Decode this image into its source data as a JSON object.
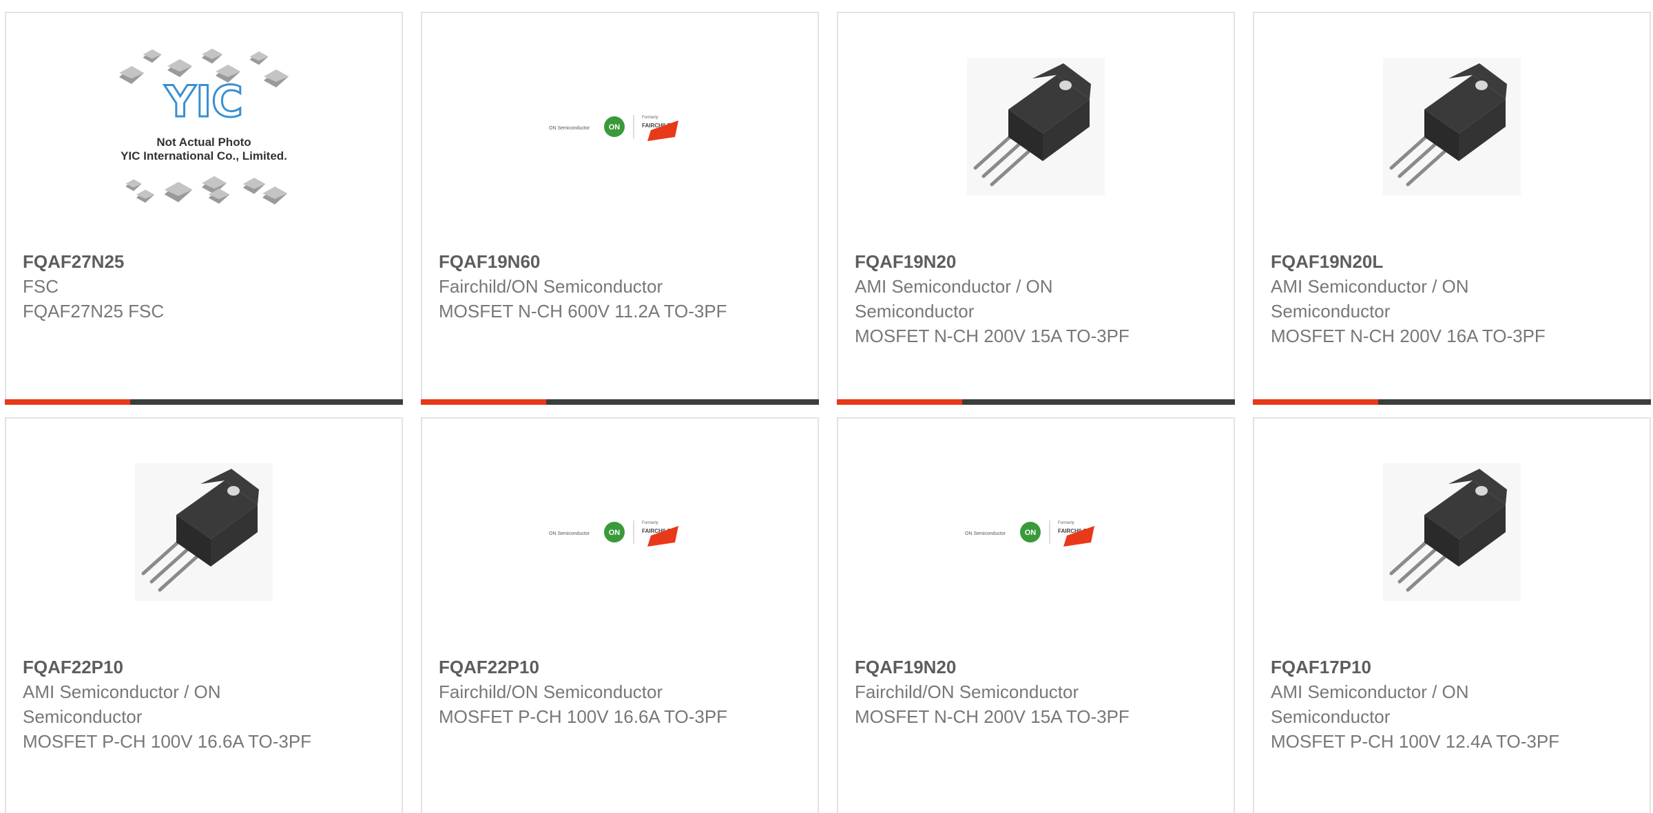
{
  "products": [
    {
      "part": "FQAF27N25",
      "manufacturer": "FSC",
      "description": "FQAF27N25 FSC",
      "image": "yic-placeholder",
      "placeholder": {
        "line1": "Not Actual Photo",
        "line2": "YIC International Co., Limited.",
        "logo": "YIC"
      }
    },
    {
      "part": "FQAF19N60",
      "manufacturer": "Fairchild/ON Semiconductor",
      "description": "MOSFET N-CH 600V 11.2A TO-3PF",
      "image": "on-fairchild-logo"
    },
    {
      "part": "FQAF19N20",
      "manufacturer": "AMI Semiconductor / ON Semiconductor",
      "description": "MOSFET N-CH 200V 15A TO-3PF",
      "image": "transistor-photo"
    },
    {
      "part": "FQAF19N20L",
      "manufacturer": "AMI Semiconductor / ON Semiconductor",
      "description": "MOSFET N-CH 200V 16A TO-3PF",
      "image": "transistor-photo"
    },
    {
      "part": "FQAF22P10",
      "manufacturer": "AMI Semiconductor / ON Semiconductor",
      "description": "MOSFET P-CH 100V 16.6A TO-3PF",
      "image": "transistor-photo"
    },
    {
      "part": "FQAF22P10",
      "manufacturer": "Fairchild/ON Semiconductor",
      "description": "MOSFET P-CH 100V 16.6A TO-3PF",
      "image": "on-fairchild-logo"
    },
    {
      "part": "FQAF19N20",
      "manufacturer": "Fairchild/ON Semiconductor",
      "description": "MOSFET N-CH 200V 15A TO-3PF",
      "image": "on-fairchild-logo"
    },
    {
      "part": "FQAF17P10",
      "manufacturer": "AMI Semiconductor / ON Semiconductor",
      "description": "MOSFET P-CH 100V 12.4A TO-3PF",
      "image": "transistor-photo"
    }
  ],
  "logo": {
    "on_semi_text": "ON Semiconductor",
    "on_badge": "ON",
    "formerly": "Formerly",
    "fairchild": "FAIRCHILD"
  },
  "colors": {
    "accent": "#e8391a",
    "bar_dark": "#3d3d3d",
    "border": "#e3e3e3",
    "part_text": "#5d5d5d",
    "body_text": "#777777"
  }
}
